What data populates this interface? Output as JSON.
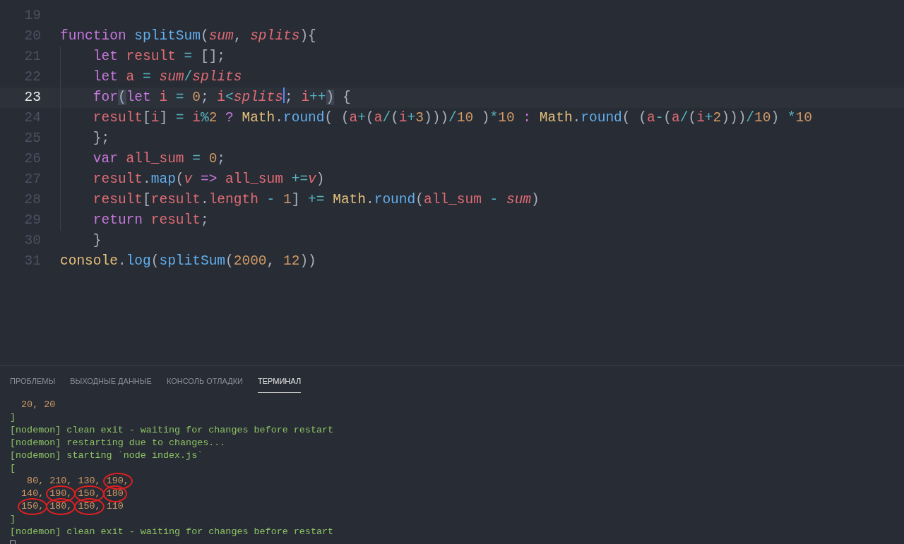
{
  "editor": {
    "lines": [
      {
        "number": "19",
        "current": false
      },
      {
        "number": "20",
        "current": false,
        "tokens": [
          {
            "text": "function ",
            "kind": "keyword"
          },
          {
            "text": "splitSum",
            "kind": "function"
          },
          {
            "text": "(",
            "kind": "plain"
          },
          {
            "text": "sum",
            "kind": "param"
          },
          {
            "text": ", ",
            "kind": "plain"
          },
          {
            "text": "splits",
            "kind": "param"
          },
          {
            "text": "){",
            "kind": "plain"
          }
        ]
      },
      {
        "number": "21",
        "current": false,
        "tokens": [
          {
            "text": "    let",
            "kind": "keyword"
          },
          {
            "text": " result",
            "kind": "variable"
          },
          {
            "text": " =",
            "kind": "operator"
          },
          {
            "text": " [];",
            "kind": "plain"
          }
        ]
      },
      {
        "number": "22",
        "current": false,
        "tokens": [
          {
            "text": "    let",
            "kind": "keyword"
          },
          {
            "text": " a",
            "kind": "variable"
          },
          {
            "text": " = ",
            "kind": "operator"
          },
          {
            "text": "sum",
            "kind": "param"
          },
          {
            "text": "/",
            "kind": "operator"
          },
          {
            "text": "splits",
            "kind": "param"
          }
        ]
      },
      {
        "number": "23",
        "current": true,
        "tokens": [
          {
            "text": "    for",
            "kind": "keyword"
          },
          {
            "text": "(",
            "kind": "match"
          },
          {
            "text": "let",
            "kind": "keyword"
          },
          {
            "text": " i",
            "kind": "variable"
          },
          {
            "text": " =",
            "kind": "operator"
          },
          {
            "text": " 0",
            "kind": "number"
          },
          {
            "text": ";",
            "kind": "plain"
          },
          {
            "text": " i",
            "kind": "variable"
          },
          {
            "text": "<",
            "kind": "operator"
          },
          {
            "text": "splits",
            "kind": "param",
            "cursor": true
          },
          {
            "text": ";",
            "kind": "plain"
          },
          {
            "text": " i",
            "kind": "variable"
          },
          {
            "text": "++",
            "kind": "operator"
          },
          {
            "text": ")",
            "kind": "match"
          },
          {
            "text": " {",
            "kind": "plain"
          }
        ]
      },
      {
        "number": "24",
        "current": false,
        "tokens": [
          {
            "text": "    result",
            "kind": "variable"
          },
          {
            "text": "[",
            "kind": "plain"
          },
          {
            "text": "i",
            "kind": "variable"
          },
          {
            "text": "]",
            "kind": "plain"
          },
          {
            "text": " =",
            "kind": "operator"
          },
          {
            "text": " i",
            "kind": "variable"
          },
          {
            "text": "%",
            "kind": "operator"
          },
          {
            "text": "2",
            "kind": "number"
          },
          {
            "text": " ?",
            "kind": "keyword"
          },
          {
            "text": " Math",
            "kind": "class"
          },
          {
            "text": ".",
            "kind": "plain"
          },
          {
            "text": "round",
            "kind": "function"
          },
          {
            "text": "( (",
            "kind": "plain"
          },
          {
            "text": "a",
            "kind": "variable"
          },
          {
            "text": "+",
            "kind": "operator"
          },
          {
            "text": "(",
            "kind": "plain"
          },
          {
            "text": "a",
            "kind": "variable"
          },
          {
            "text": "/",
            "kind": "operator"
          },
          {
            "text": "(",
            "kind": "plain"
          },
          {
            "text": "i",
            "kind": "variable"
          },
          {
            "text": "+",
            "kind": "operator"
          },
          {
            "text": "3",
            "kind": "number"
          },
          {
            "text": ")))",
            "kind": "plain"
          },
          {
            "text": "/",
            "kind": "operator"
          },
          {
            "text": "10",
            "kind": "number"
          },
          {
            "text": " )",
            "kind": "plain"
          },
          {
            "text": "*",
            "kind": "operator"
          },
          {
            "text": "10",
            "kind": "number"
          },
          {
            "text": " :",
            "kind": "keyword"
          },
          {
            "text": " Math",
            "kind": "class"
          },
          {
            "text": ".",
            "kind": "plain"
          },
          {
            "text": "round",
            "kind": "function"
          },
          {
            "text": "( (",
            "kind": "plain"
          },
          {
            "text": "a",
            "kind": "variable"
          },
          {
            "text": "-",
            "kind": "operator"
          },
          {
            "text": "(",
            "kind": "plain"
          },
          {
            "text": "a",
            "kind": "variable"
          },
          {
            "text": "/",
            "kind": "operator"
          },
          {
            "text": "(",
            "kind": "plain"
          },
          {
            "text": "i",
            "kind": "variable"
          },
          {
            "text": "+",
            "kind": "operator"
          },
          {
            "text": "2",
            "kind": "number"
          },
          {
            "text": ")))",
            "kind": "plain"
          },
          {
            "text": "/",
            "kind": "operator"
          },
          {
            "text": "10",
            "kind": "number"
          },
          {
            "text": ")",
            "kind": "plain"
          },
          {
            "text": " *",
            "kind": "operator"
          },
          {
            "text": "10",
            "kind": "number"
          }
        ]
      },
      {
        "number": "25",
        "current": false,
        "tokens": [
          {
            "text": "    };",
            "kind": "plain"
          }
        ]
      },
      {
        "number": "26",
        "current": false,
        "tokens": [
          {
            "text": "    var",
            "kind": "keyword"
          },
          {
            "text": " all_sum",
            "kind": "variable"
          },
          {
            "text": " =",
            "kind": "operator"
          },
          {
            "text": " 0",
            "kind": "number"
          },
          {
            "text": ";",
            "kind": "plain"
          }
        ]
      },
      {
        "number": "27",
        "current": false,
        "tokens": [
          {
            "text": "    result",
            "kind": "variable"
          },
          {
            "text": ".",
            "kind": "plain"
          },
          {
            "text": "map",
            "kind": "function"
          },
          {
            "text": "(",
            "kind": "plain"
          },
          {
            "text": "v",
            "kind": "param"
          },
          {
            "text": " =>",
            "kind": "keyword"
          },
          {
            "text": " all_sum",
            "kind": "variable"
          },
          {
            "text": " +=",
            "kind": "operator"
          },
          {
            "text": "v",
            "kind": "param"
          },
          {
            "text": ")",
            "kind": "plain"
          }
        ]
      },
      {
        "number": "28",
        "current": false,
        "tokens": [
          {
            "text": "    result",
            "kind": "variable"
          },
          {
            "text": "[",
            "kind": "plain"
          },
          {
            "text": "result",
            "kind": "variable"
          },
          {
            "text": ".",
            "kind": "plain"
          },
          {
            "text": "length",
            "kind": "variable"
          },
          {
            "text": " -",
            "kind": "operator"
          },
          {
            "text": " 1",
            "kind": "number"
          },
          {
            "text": "]",
            "kind": "plain"
          },
          {
            "text": " +=",
            "kind": "operator"
          },
          {
            "text": " Math",
            "kind": "class"
          },
          {
            "text": ".",
            "kind": "plain"
          },
          {
            "text": "round",
            "kind": "function"
          },
          {
            "text": "(",
            "kind": "plain"
          },
          {
            "text": "all_sum",
            "kind": "variable"
          },
          {
            "text": " -",
            "kind": "operator"
          },
          {
            "text": " sum",
            "kind": "param"
          },
          {
            "text": ")",
            "kind": "plain"
          }
        ]
      },
      {
        "number": "29",
        "current": false,
        "tokens": [
          {
            "text": "    return",
            "kind": "keyword"
          },
          {
            "text": " result",
            "kind": "variable"
          },
          {
            "text": ";",
            "kind": "plain"
          }
        ]
      },
      {
        "number": "30",
        "current": false,
        "tokens": [
          {
            "text": "    }",
            "kind": "plain"
          }
        ]
      },
      {
        "number": "31",
        "current": false,
        "tokens": [
          {
            "text": "console",
            "kind": "class"
          },
          {
            "text": ".",
            "kind": "plain"
          },
          {
            "text": "log",
            "kind": "function"
          },
          {
            "text": "(",
            "kind": "plain"
          },
          {
            "text": "splitSum",
            "kind": "function"
          },
          {
            "text": "(",
            "kind": "plain"
          },
          {
            "text": "2000",
            "kind": "number"
          },
          {
            "text": ", ",
            "kind": "plain"
          },
          {
            "text": "12",
            "kind": "number"
          },
          {
            "text": "))",
            "kind": "plain"
          }
        ]
      }
    ]
  },
  "panel": {
    "tabs": [
      {
        "label": "ПРОБЛЕМЫ",
        "selected": false
      },
      {
        "label": "ВЫХОДНЫЕ ДАННЫЕ",
        "selected": false
      },
      {
        "label": "КОНСОЛЬ ОТЛАДКИ",
        "selected": false
      },
      {
        "label": "ТЕРМИНАЛ",
        "selected": true
      }
    ],
    "terminal": [
      {
        "kind": "array-row",
        "items": [
          {
            "text": "20,",
            "circled": false
          },
          {
            "text": "20",
            "circled": false
          }
        ]
      },
      {
        "kind": "bracket",
        "text": "]"
      },
      {
        "kind": "log",
        "text": "[nodemon] clean exit - waiting for changes before restart"
      },
      {
        "kind": "log",
        "text": "[nodemon] restarting due to changes..."
      },
      {
        "kind": "log",
        "text": "[nodemon] starting `node index.js`"
      },
      {
        "kind": "bracket",
        "text": "["
      },
      {
        "kind": "array-row",
        "items": [
          {
            "text": " 80,",
            "circled": false
          },
          {
            "text": "210,",
            "circled": false
          },
          {
            "text": "130,",
            "circled": false
          },
          {
            "text": "190,",
            "circled": true
          }
        ]
      },
      {
        "kind": "array-row",
        "items": [
          {
            "text": "140,",
            "circled": false
          },
          {
            "text": "190,",
            "circled": true
          },
          {
            "text": "150,",
            "circled": true
          },
          {
            "text": "180",
            "circled": true
          }
        ]
      },
      {
        "kind": "array-row",
        "items": [
          {
            "text": "150,",
            "circled": true
          },
          {
            "text": "180,",
            "circled": true
          },
          {
            "text": "150,",
            "circled": true
          },
          {
            "text": "110",
            "circled": false
          }
        ]
      },
      {
        "kind": "bracket",
        "text": "]"
      },
      {
        "kind": "log",
        "text": "[nodemon] clean exit - waiting for changes before restart"
      },
      {
        "kind": "cursor"
      }
    ]
  }
}
